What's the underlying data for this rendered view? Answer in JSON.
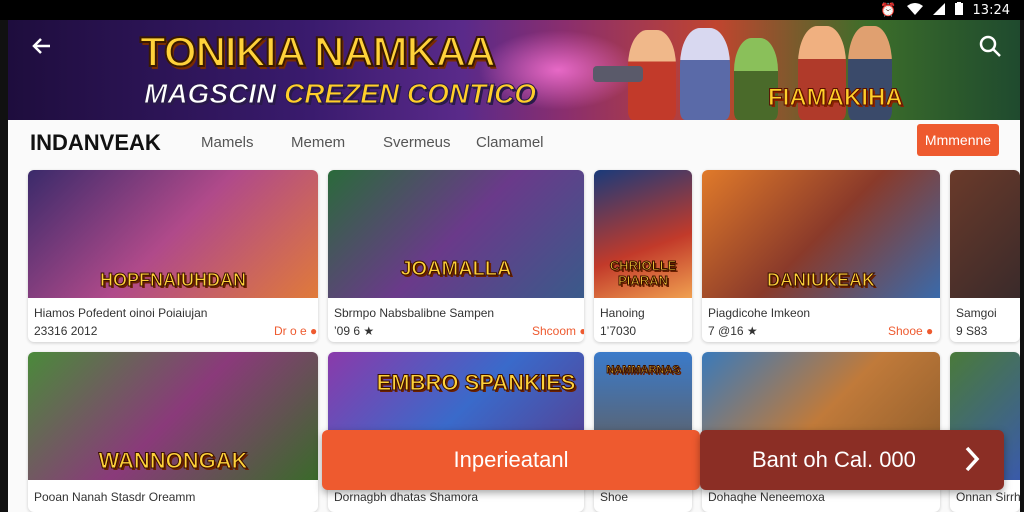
{
  "status": {
    "time": "13:24"
  },
  "hero": {
    "title_line1": "TONIKIA NAMKAA",
    "title_line2_a": "MAGSCIN ",
    "title_line2_b": "CREZEN CONTICO",
    "badge": "FIAMAKIHA"
  },
  "nav": {
    "brand": "INDANVEAK",
    "links": [
      "Mamels",
      "Memem",
      "Svermeus",
      "Clamamel"
    ],
    "cta": "Mmmenne"
  },
  "cards_row1": [
    {
      "label": "HOPFNAIUHDAN",
      "line1": "Hiamos Pofedent oinoi Poiaiujan",
      "line2": "23316 2012",
      "value": "Dr o e ●"
    },
    {
      "label": "JOAMALLA",
      "line1": "Sbrmpo Nabsbalibne Sampen",
      "line2": "’09 6 ★",
      "value": "Shcoom ●"
    },
    {
      "label": "CHRIOLLE PIARAN",
      "line1": "Hanoing",
      "line2": "1’7030",
      "value": ""
    },
    {
      "label": "DANIUKEAK",
      "line1": "Piagdicohe Imkeon",
      "line2": "7 @16 ★",
      "value": "Shooe ●"
    },
    {
      "label": "",
      "line1": "Samgoi",
      "line2": "9 S83",
      "value": ""
    }
  ],
  "cards_row2": [
    {
      "label": "WANNONGAK",
      "line1": "Pooan Nanah Stasdr Oreamm"
    },
    {
      "label": "EMBRO SPANKIES",
      "line1": "Dornagbh dhatas Shamora"
    },
    {
      "label": "NAMMARNAS",
      "line1": "Shoe"
    },
    {
      "label": "",
      "line1": "Dohaqhe Neneemoxa"
    },
    {
      "label": "",
      "line1": "Onnan Sirrhe"
    }
  ],
  "actions": {
    "primary": "Inperieatanl",
    "secondary": "Bant oh Cal. 000"
  },
  "colors": {
    "accent": "#ee5a2f",
    "dark_accent": "#8b2e25"
  }
}
